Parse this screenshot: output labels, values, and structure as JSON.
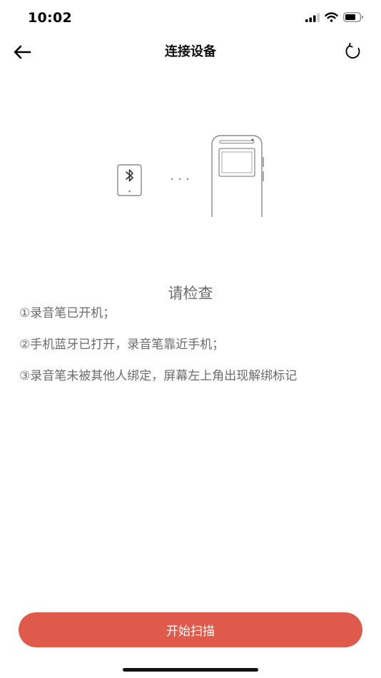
{
  "status_bar": {
    "time": "10:02",
    "icons": [
      "signal-icon",
      "wifi-icon",
      "battery-icon"
    ]
  },
  "nav": {
    "title": "连接设备",
    "back_icon": "arrow-left-icon",
    "refresh_icon": "refresh-icon"
  },
  "illustration": {
    "phone_icon": "bluetooth-icon",
    "dots": "· · ·"
  },
  "check": {
    "title": "请检查",
    "items": [
      "①录音笔已开机；",
      "②手机蓝牙已打开，录音笔靠近手机；",
      "③录音笔未被其他人绑定，屏幕左上角出现解绑标记"
    ]
  },
  "actions": {
    "scan_label": "开始扫描"
  },
  "colors": {
    "accent": "#e05a4b",
    "text_muted": "#6b6b6b"
  }
}
